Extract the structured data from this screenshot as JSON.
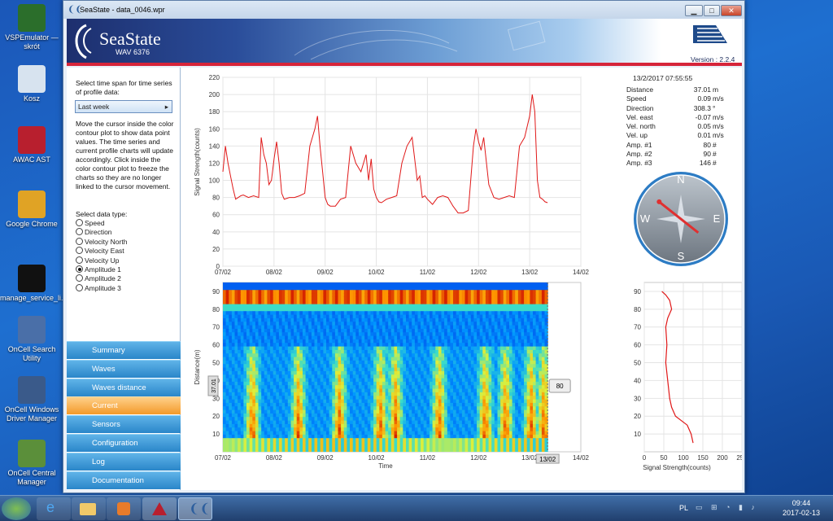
{
  "desktop_icons": [
    {
      "label": "VSPEmulator — skrót",
      "color": "#2b6e2b"
    },
    {
      "label": "Kosz",
      "color": "#d7e3ef"
    },
    {
      "label": "AWAC AST",
      "color": "#b81f2e"
    },
    {
      "label": "Google Chrome",
      "color": "#e0a325"
    },
    {
      "label": "manage_service_li...",
      "color": "#111111"
    },
    {
      "label": "OnCell Search Utility",
      "color": "#4a6fa8"
    },
    {
      "label": "OnCell Windows Driver Manager",
      "color": "#3a5a8a"
    },
    {
      "label": "OnCell Central Manager",
      "color": "#5b8f3a"
    }
  ],
  "window": {
    "title": "SeaState - data_0046.wpr",
    "minimize": "▁",
    "maximize": "□",
    "close": "✕"
  },
  "banner": {
    "brand": "SeaState",
    "subtitle": "WAV 6376",
    "version": "Version : 2.2.4"
  },
  "left_panel": {
    "timespan_prompt": "Select time span for time series of profile data:",
    "timespan_value": "Last week",
    "help_text": "Move the cursor inside the color contour plot to show data point values. The time series and current profile charts will update accordingly. Click inside the color contour plot to freeze the charts so they are no longer linked to the cursor movement.",
    "datatype_prompt": "Select data type:",
    "datatypes": [
      {
        "label": "Speed",
        "selected": false
      },
      {
        "label": "Direction",
        "selected": false
      },
      {
        "label": "Velocity North",
        "selected": false
      },
      {
        "label": "Velocity East",
        "selected": false
      },
      {
        "label": "Velocity Up",
        "selected": false
      },
      {
        "label": "Amplitude 1",
        "selected": true
      },
      {
        "label": "Amplitude 2",
        "selected": false
      },
      {
        "label": "Amplitude 3",
        "selected": false
      }
    ]
  },
  "nav": [
    {
      "label": "Summary",
      "active": false
    },
    {
      "label": "Waves",
      "active": false
    },
    {
      "label": "Waves distance",
      "active": false
    },
    {
      "label": "Current",
      "active": true
    },
    {
      "label": "Sensors",
      "active": false
    },
    {
      "label": "Configuration",
      "active": false
    },
    {
      "label": "Log",
      "active": false
    },
    {
      "label": "Documentation",
      "active": false
    }
  ],
  "info": {
    "timestamp": "13/2/2017 07:55:55",
    "rows": [
      {
        "label": "Distance",
        "value": "37.01",
        "unit": "m"
      },
      {
        "label": "Speed",
        "value": "0.09",
        "unit": "m/s"
      },
      {
        "label": "Direction",
        "value": "308.3",
        "unit": "°"
      },
      {
        "label": "Vel. east",
        "value": "-0.07",
        "unit": "m/s"
      },
      {
        "label": "Vel. north",
        "value": "0.05",
        "unit": "m/s"
      },
      {
        "label": "Vel. up",
        "value": "0.01",
        "unit": "m/s"
      },
      {
        "label": "Amp. #1",
        "value": "80",
        "unit": "#"
      },
      {
        "label": "Amp. #2",
        "value": "90",
        "unit": "#"
      },
      {
        "label": "Amp. #3",
        "value": "146",
        "unit": "#"
      }
    ]
  },
  "compass": {
    "n": "N",
    "e": "E",
    "s": "S",
    "w": "W",
    "direction_deg": 308.3
  },
  "chart_data": [
    {
      "type": "line",
      "ylabel": "Signal Strength(counts)",
      "ylim": [
        0,
        220
      ],
      "yticks": [
        0,
        20,
        40,
        60,
        80,
        100,
        120,
        140,
        160,
        180,
        200,
        220
      ],
      "xticks": [
        "07/02",
        "08/02",
        "09/02",
        "10/02",
        "11/02",
        "12/02",
        "13/02",
        "14/02"
      ],
      "xlim": [
        0,
        7
      ],
      "color": "#e01818",
      "series": [
        {
          "x": [
            0,
            0.05,
            0.1,
            0.15,
            0.2,
            0.25,
            0.3,
            0.35,
            0.4,
            0.5,
            0.6,
            0.7,
            0.75,
            0.8,
            0.85,
            0.9,
            0.95,
            1.0,
            1.05,
            1.1,
            1.15,
            1.2,
            1.3,
            1.4,
            1.5,
            1.6,
            1.7,
            1.8,
            1.85,
            1.9,
            1.95,
            2.0,
            2.05,
            2.1,
            2.2,
            2.3,
            2.4,
            2.5,
            2.6,
            2.7,
            2.8,
            2.85,
            2.9,
            2.95,
            3.0,
            3.05,
            3.1,
            3.2,
            3.3,
            3.4,
            3.5,
            3.6,
            3.7,
            3.8,
            3.85,
            3.9,
            3.95,
            4.0,
            4.05,
            4.1,
            4.2,
            4.3,
            4.4,
            4.5,
            4.6,
            4.7,
            4.8,
            4.9,
            4.95,
            5.0,
            5.05,
            5.1,
            5.2,
            5.3,
            5.4,
            5.5,
            5.6,
            5.7,
            5.8,
            5.9,
            6.0,
            6.05,
            6.1,
            6.15,
            6.2,
            6.25,
            6.3,
            6.35
          ],
          "values": [
            110,
            140,
            120,
            105,
            90,
            78,
            80,
            82,
            83,
            80,
            82,
            80,
            150,
            130,
            120,
            95,
            100,
            125,
            145,
            120,
            85,
            78,
            80,
            80,
            82,
            85,
            140,
            160,
            175,
            140,
            110,
            80,
            72,
            70,
            70,
            78,
            80,
            140,
            120,
            110,
            130,
            100,
            125,
            90,
            80,
            75,
            74,
            78,
            80,
            82,
            120,
            140,
            150,
            100,
            105,
            80,
            82,
            78,
            75,
            72,
            80,
            82,
            80,
            70,
            62,
            62,
            65,
            140,
            160,
            145,
            135,
            150,
            95,
            80,
            78,
            80,
            82,
            80,
            140,
            150,
            175,
            200,
            180,
            100,
            80,
            78,
            75,
            74
          ]
        }
      ]
    },
    {
      "type": "heatmap",
      "ylabel": "Distance(m)",
      "xlabel": "Time",
      "ylim": [
        0,
        95
      ],
      "yticks": [
        10,
        20,
        30,
        40,
        50,
        60,
        70,
        80,
        90
      ],
      "xticks": [
        "07/02",
        "08/02",
        "09/02",
        "10/02",
        "11/02",
        "12/02",
        "13/02",
        "14/02"
      ],
      "cursor_x_label": "13/02",
      "cursor_y_label": "37.01",
      "cursor_value_label": "80"
    },
    {
      "type": "line",
      "xlabel": "Signal Strength(counts)",
      "xlim": [
        0,
        250
      ],
      "xticks": [
        0,
        50,
        100,
        150,
        200,
        250
      ],
      "yticks": [
        10,
        20,
        30,
        40,
        50,
        60,
        70,
        80,
        90
      ],
      "ylim": [
        0,
        95
      ],
      "color": "#e01818",
      "profile": {
        "distance": [
          5,
          10,
          15,
          20,
          25,
          30,
          40,
          50,
          60,
          70,
          75,
          80,
          85,
          88,
          90
        ],
        "value": [
          125,
          120,
          110,
          80,
          70,
          65,
          60,
          55,
          58,
          55,
          60,
          70,
          65,
          55,
          45
        ]
      }
    }
  ],
  "taskbar": {
    "lang": "PL",
    "time": "09:44",
    "date": "2017-02-13"
  }
}
